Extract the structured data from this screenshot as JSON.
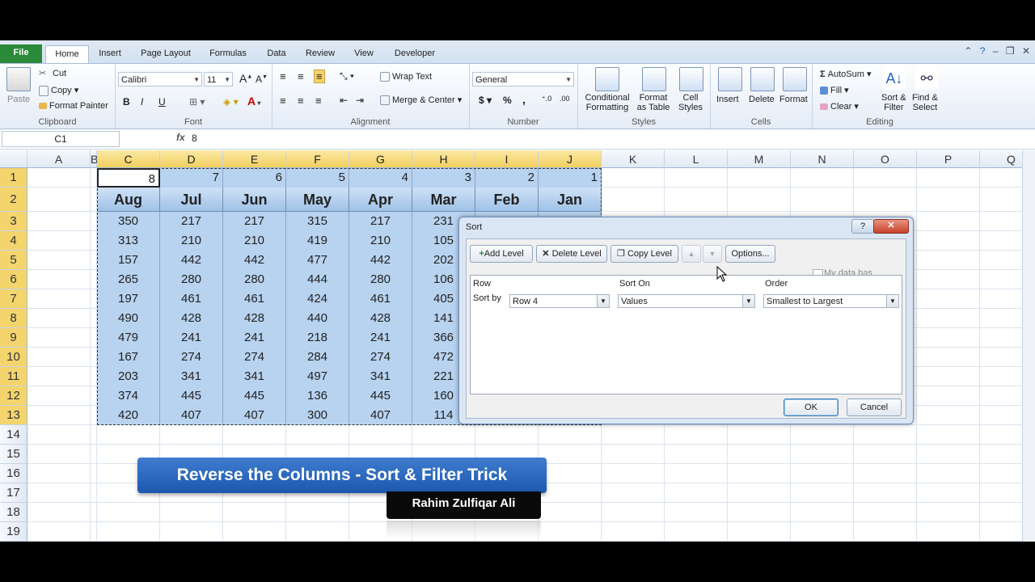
{
  "ribbon": {
    "tabs": [
      "File",
      "Home",
      "Insert",
      "Page Layout",
      "Formulas",
      "Data",
      "Review",
      "View",
      "Developer"
    ],
    "active_tab": "Home",
    "clipboard": {
      "paste": "Paste",
      "cut": "Cut",
      "copy": "Copy",
      "format_painter": "Format Painter",
      "label": "Clipboard"
    },
    "font": {
      "name": "Calibri",
      "size": "11",
      "bold": "B",
      "italic": "I",
      "underline": "U",
      "label": "Font"
    },
    "alignment": {
      "wrap_text": "Wrap Text",
      "merge_center": "Merge & Center",
      "label": "Alignment"
    },
    "number": {
      "format": "General",
      "currency": "$",
      "percent": "%",
      "comma": ",",
      "label": "Number"
    },
    "styles": {
      "conditional": "Conditional",
      "conditional2": "Formatting",
      "format_as": "Format",
      "format_as2": "as Table",
      "cell": "Cell",
      "cell2": "Styles",
      "label": "Styles"
    },
    "cells": {
      "insert": "Insert",
      "delete": "Delete",
      "format": "Format",
      "label": "Cells"
    },
    "editing": {
      "autosum": "AutoSum",
      "fill": "Fill",
      "clear": "Clear",
      "sort": "Sort &",
      "sort2": "Filter",
      "find": "Find &",
      "find2": "Select",
      "label": "Editing"
    }
  },
  "formula_bar": {
    "name_box": "C1",
    "fx": "fx",
    "value": "8"
  },
  "columns": [
    "A",
    "B",
    "C",
    "D",
    "E",
    "F",
    "G",
    "H",
    "I",
    "J",
    "K",
    "L",
    "M",
    "N",
    "O",
    "P",
    "Q"
  ],
  "rows": [
    "1",
    "2",
    "3",
    "4",
    "5",
    "6",
    "7",
    "8",
    "9",
    "10",
    "11",
    "12",
    "13",
    "14",
    "15",
    "16",
    "17",
    "18",
    "19"
  ],
  "table": {
    "row1": [
      "8",
      "7",
      "6",
      "5",
      "4",
      "3",
      "2",
      "1"
    ],
    "headers": [
      "Aug",
      "Jul",
      "Jun",
      "May",
      "Apr",
      "Mar",
      "Feb",
      "Jan"
    ],
    "data": [
      [
        "350",
        "217",
        "217",
        "315",
        "217",
        "231",
        "",
        ""
      ],
      [
        "313",
        "210",
        "210",
        "419",
        "210",
        "105",
        "",
        ""
      ],
      [
        "157",
        "442",
        "442",
        "477",
        "442",
        "202",
        "",
        ""
      ],
      [
        "265",
        "280",
        "280",
        "444",
        "280",
        "106",
        "",
        ""
      ],
      [
        "197",
        "461",
        "461",
        "424",
        "461",
        "405",
        "",
        ""
      ],
      [
        "490",
        "428",
        "428",
        "440",
        "428",
        "141",
        "",
        ""
      ],
      [
        "479",
        "241",
        "241",
        "218",
        "241",
        "366",
        "",
        ""
      ],
      [
        "167",
        "274",
        "274",
        "284",
        "274",
        "472",
        "",
        ""
      ],
      [
        "203",
        "341",
        "341",
        "497",
        "341",
        "221",
        "",
        ""
      ],
      [
        "374",
        "445",
        "445",
        "136",
        "445",
        "160",
        "",
        ""
      ],
      [
        "420",
        "407",
        "407",
        "300",
        "407",
        "114",
        "",
        ""
      ]
    ]
  },
  "dialog": {
    "title": "Sort",
    "help": "?",
    "close": "✕",
    "add_level": "Add Level",
    "delete_level": "Delete Level",
    "copy_level": "Copy Level",
    "up": "▲",
    "down": "▼",
    "options": "Options...",
    "has_headers": "My data has headers",
    "col_row": "Row",
    "col_sorton": "Sort On",
    "col_order": "Order",
    "sort_by": "Sort by",
    "row_value": "Row 4",
    "sorton_value": "Values",
    "order_value": "Smallest to Largest",
    "ok": "OK",
    "cancel": "Cancel"
  },
  "banner": {
    "title": "Reverse the Columns - Sort & Filter Trick",
    "author": "Rahim Zulfiqar Ali"
  }
}
